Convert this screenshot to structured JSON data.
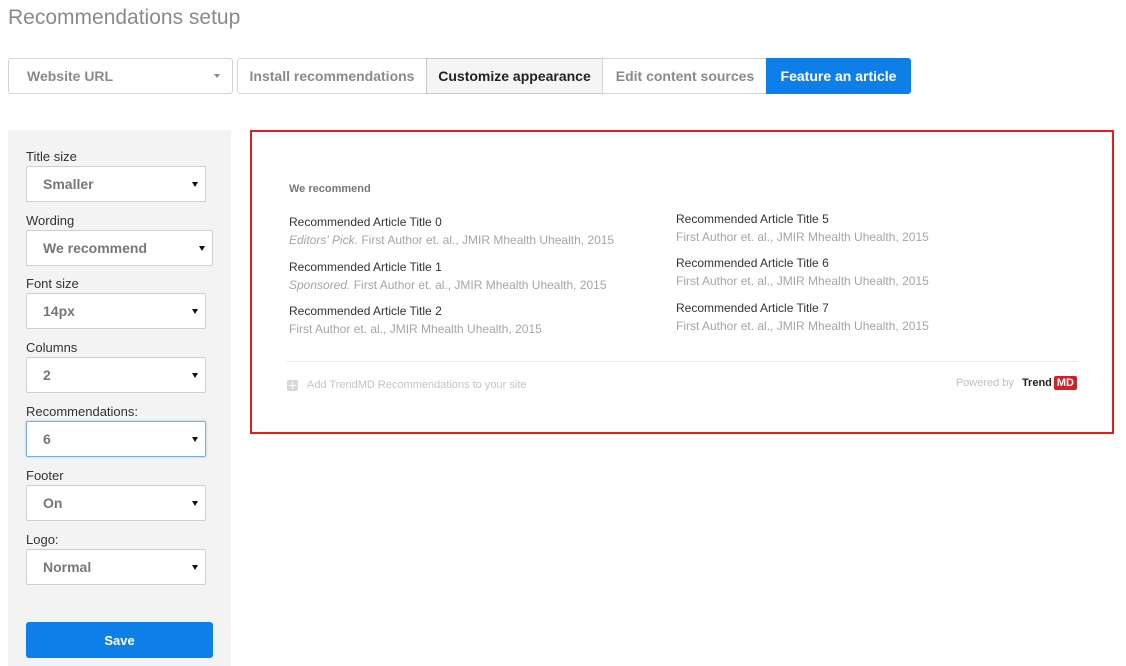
{
  "page": {
    "title": "Recommendations setup"
  },
  "nav": {
    "website_url": "Website URL",
    "install": "Install recommendations",
    "customize": "Customize appearance",
    "edit_sources": "Edit content sources",
    "feature": "Feature an article"
  },
  "settings": {
    "title_size": {
      "label": "Title size",
      "value": "Smaller"
    },
    "wording": {
      "label": "Wording",
      "value": "We recommend"
    },
    "font_size": {
      "label": "Font size",
      "value": "14px"
    },
    "columns": {
      "label": "Columns",
      "value": "2"
    },
    "recommendations": {
      "label": "Recommendations:",
      "value": "6"
    },
    "footer": {
      "label": "Footer",
      "value": "On"
    },
    "logo": {
      "label": "Logo:",
      "value": "Normal"
    },
    "save": "Save"
  },
  "preview": {
    "heading": "We recommend",
    "items": [
      {
        "title": "Recommended Article Title 0",
        "tag": "Editors' Pick.",
        "meta": " First Author et. al., JMIR Mhealth Uhealth, 2015"
      },
      {
        "title": "Recommended Article Title 1",
        "tag": "Sponsored.",
        "meta": " First Author et. al., JMIR Mhealth Uhealth, 2015"
      },
      {
        "title": "Recommended Article Title 2",
        "tag": "",
        "meta": "First Author et. al., JMIR Mhealth Uhealth, 2015"
      },
      {
        "title": "Recommended Article Title 5",
        "tag": "",
        "meta": "First Author et. al., JMIR Mhealth Uhealth, 2015"
      },
      {
        "title": "Recommended Article Title 6",
        "tag": "",
        "meta": "First Author et. al., JMIR Mhealth Uhealth, 2015"
      },
      {
        "title": "Recommended Article Title 7",
        "tag": "",
        "meta": "First Author et. al., JMIR Mhealth Uhealth, 2015"
      }
    ],
    "footer_add": "Add TrendMD Recommendations to your site",
    "powered_by": "Powered by",
    "logo_trend": "Trend",
    "logo_md": "MD"
  },
  "colors": {
    "accent": "#0d7fe6",
    "preview_border": "#e31c1c",
    "logo_red": "#d0202a"
  }
}
